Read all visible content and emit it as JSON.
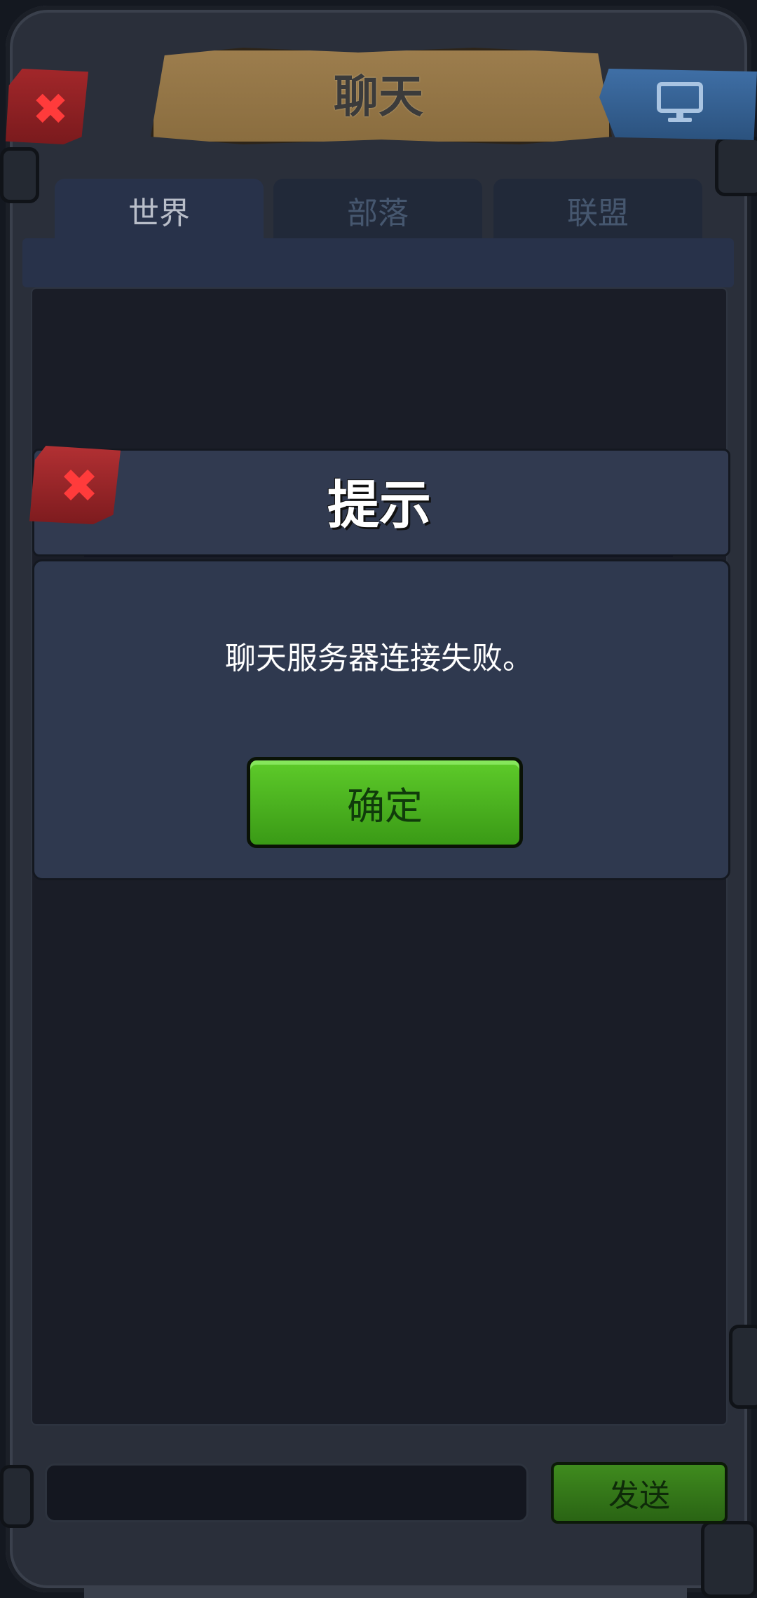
{
  "header": {
    "title": "聊天"
  },
  "tabs": [
    {
      "label": "世界",
      "active": true
    },
    {
      "label": "部落",
      "active": false
    },
    {
      "label": "联盟",
      "active": false
    }
  ],
  "dialog": {
    "title": "提示",
    "message": "聊天服务器连接失败。",
    "ok_label": "确定"
  },
  "footer": {
    "send_label": "发送",
    "input_value": ""
  },
  "icons": {
    "close": "close-icon",
    "monitor": "monitor-icon"
  },
  "colors": {
    "ok_green": "#4fb321",
    "close_red": "#ff3b3b",
    "send_green": "#2f6d15"
  }
}
